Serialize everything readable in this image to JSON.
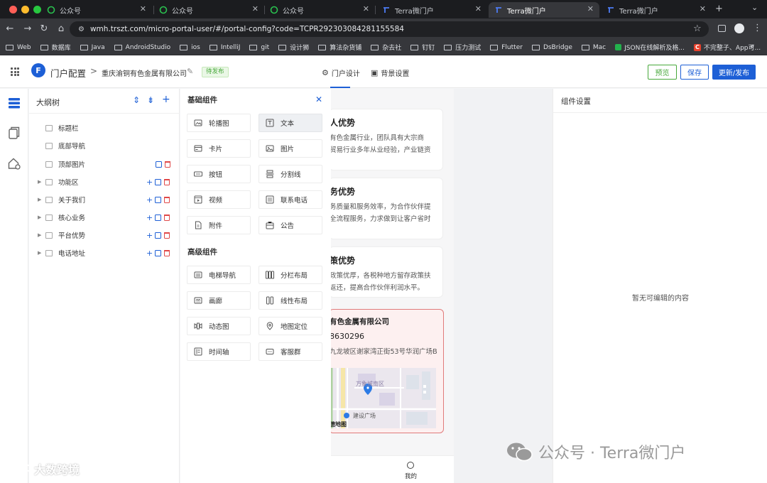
{
  "browser": {
    "tabs": [
      {
        "title": "公众号",
        "icon": "wechat-icon"
      },
      {
        "title": "公众号",
        "icon": "wechat-icon"
      },
      {
        "title": "公众号",
        "icon": "wechat-icon"
      },
      {
        "title": "Terra微门户",
        "icon": "terra-icon"
      },
      {
        "title": "Terra微门户",
        "icon": "terra-icon",
        "active": true
      },
      {
        "title": "Terra微门户",
        "icon": "terra-icon"
      }
    ],
    "new_tab_symbol": "+",
    "menu_symbol": "⌄",
    "url": "wmh.trszt.com/micro-portal-user/#/portal-config?code=TCPR292303084281155584",
    "bookmarks": [
      "Web",
      "数据库",
      "Java",
      "AndroidStudio",
      "ios",
      "IntelliJ",
      "git",
      "设计狮",
      "算法杂货铺",
      "杂去社",
      "钉钉",
      "压力测试",
      "Flutter",
      "DsBridge",
      "Mac",
      "JSON在线解析及格...",
      "不完整子、App可..."
    ],
    "bookmarks_more": "»"
  },
  "topbar": {
    "logo_text": "F",
    "app_title": "门户配置",
    "crumb_sep": ">",
    "company": "重庆渝铜有色金属有限公司",
    "status": "待发布",
    "nav": [
      {
        "label": "门户设计",
        "icon": "gear-icon"
      },
      {
        "label": "背景设置",
        "icon": "image-icon"
      }
    ],
    "buttons": {
      "preview": "预览",
      "save": "保存",
      "publish": "更新/发布"
    }
  },
  "outline": {
    "title": "大纲树",
    "items": [
      {
        "label": "标题栏",
        "expandable": false,
        "actions": false
      },
      {
        "label": "底部导航",
        "expandable": false,
        "actions": false
      },
      {
        "label": "顶部图片",
        "expandable": false,
        "actions": "copy-delete"
      },
      {
        "label": "功能区",
        "expandable": true,
        "actions": "all"
      },
      {
        "label": "关于我们",
        "expandable": true,
        "actions": "all"
      },
      {
        "label": "核心业务",
        "expandable": true,
        "actions": "all"
      },
      {
        "label": "平台优势",
        "expandable": true,
        "actions": "all"
      },
      {
        "label": "电话地址",
        "expandable": true,
        "actions": "all"
      }
    ]
  },
  "components": {
    "basic_title": "基础组件",
    "basic": [
      {
        "label": "轮播图",
        "icon": "carousel-icon"
      },
      {
        "label": "文本",
        "icon": "text-icon"
      },
      {
        "label": "卡片",
        "icon": "card-icon"
      },
      {
        "label": "图片",
        "icon": "image-icon"
      },
      {
        "label": "按钮",
        "icon": "button-icon"
      },
      {
        "label": "分割线",
        "icon": "divider-icon"
      },
      {
        "label": "视频",
        "icon": "video-icon"
      },
      {
        "label": "联系电话",
        "icon": "phone-icon"
      },
      {
        "label": "附件",
        "icon": "attachment-icon"
      },
      {
        "label": "公告",
        "icon": "notice-icon"
      }
    ],
    "advanced_title": "高级组件",
    "advanced": [
      {
        "label": "电梯导航",
        "icon": "elevator-nav-icon"
      },
      {
        "label": "分栏布局",
        "icon": "columns-icon"
      },
      {
        "label": "画廊",
        "icon": "gallery-icon"
      },
      {
        "label": "线性布局",
        "icon": "linear-layout-icon"
      },
      {
        "label": "动态图",
        "icon": "animated-image-icon"
      },
      {
        "label": "地图定位",
        "icon": "map-pin-icon"
      },
      {
        "label": "时间轴",
        "icon": "timeline-icon"
      },
      {
        "label": "客服群",
        "icon": "service-group-icon"
      }
    ]
  },
  "preview": {
    "cards": [
      {
        "title": "人优势",
        "lines": [
          "有色金属行业，团队具有大宗商",
          "贸易行业多年从业经验，产业链资"
        ]
      },
      {
        "title": "务优势",
        "lines": [
          "务质量和服务效率，为合作伙伴提",
          "全流程服务，力求做到让客户省时"
        ]
      },
      {
        "title": "策优势",
        "lines": [
          "政策优厚，各税种地方留存政策扶",
          "返还，提高合作伙伴利润水平。"
        ]
      }
    ],
    "contact": {
      "name": "有色金属有限公司",
      "phone": "8630296",
      "address": "九龙坡区谢家湾正街53号华润广场B"
    },
    "map_labels": {
      "district": "万象城南区",
      "plaza": "建设广场",
      "brand": "德地图"
    },
    "bottom_tab": "我的"
  },
  "settings": {
    "title": "组件设置",
    "empty": "暂无可编辑的内容"
  },
  "watermarks": {
    "left": "大数跨境",
    "right": "公众号 · Terra微门户"
  },
  "colors": {
    "primary": "#1d5fd6",
    "success": "#47a83a",
    "danger": "#e04848"
  }
}
